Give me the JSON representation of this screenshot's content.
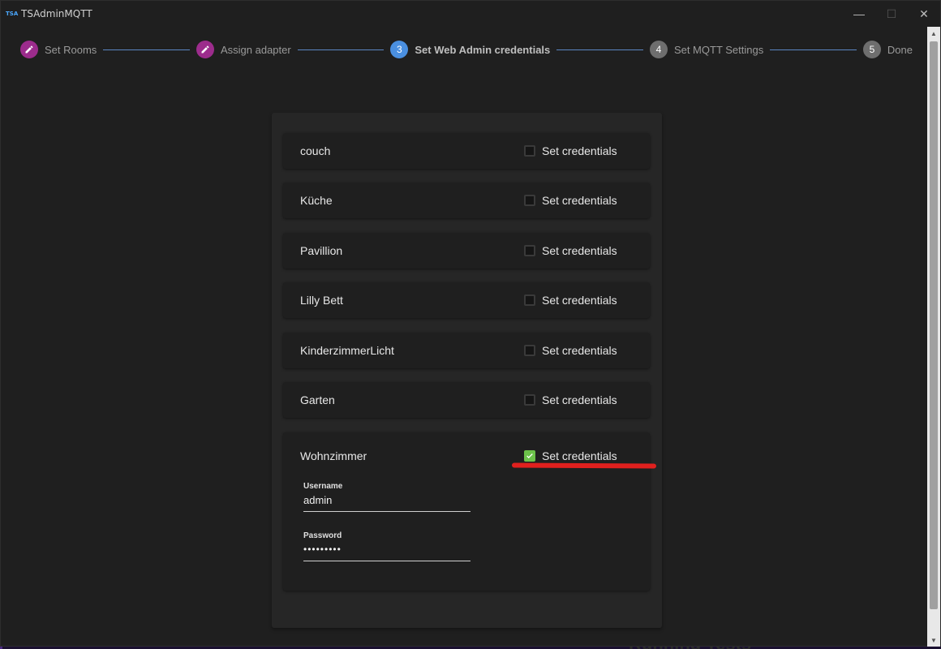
{
  "window": {
    "app_icon": "TSA",
    "title": "TSAdminMQTT",
    "controls": {
      "minimize": "—",
      "maximize": "☐",
      "close": "✕"
    }
  },
  "stepper": {
    "steps": [
      {
        "number": "",
        "icon": "pencil-icon",
        "label": "Set Rooms",
        "state": "done"
      },
      {
        "number": "",
        "icon": "pencil-icon",
        "label": "Assign adapter",
        "state": "done"
      },
      {
        "number": "3",
        "label": "Set Web Admin credentials",
        "state": "active"
      },
      {
        "number": "4",
        "label": "Set MQTT Settings",
        "state": "todo"
      },
      {
        "number": "5",
        "label": "Done",
        "state": "todo"
      }
    ]
  },
  "rooms": [
    {
      "name": "couch",
      "checkbox_label": "Set credentials",
      "checked": false
    },
    {
      "name": "Küche",
      "checkbox_label": "Set credentials",
      "checked": false
    },
    {
      "name": "Pavillion",
      "checkbox_label": "Set credentials",
      "checked": false
    },
    {
      "name": "Lilly Bett",
      "checkbox_label": "Set credentials",
      "checked": false
    },
    {
      "name": "KinderzimmerLicht",
      "checkbox_label": "Set credentials",
      "checked": false
    },
    {
      "name": "Garten",
      "checkbox_label": "Set credentials",
      "checked": false
    },
    {
      "name": "Wohnzimmer",
      "checkbox_label": "Set credentials",
      "checked": true,
      "username_label": "Username",
      "username_value": "admin",
      "password_label": "Password",
      "password_value": "•••••••••"
    }
  ],
  "background": {
    "desktop_text": "Running Tests"
  },
  "colors": {
    "step_done": "#9c2c8c",
    "step_active": "#4a8fe0",
    "step_todo": "#6e6e6e",
    "checkbox_checked": "#6cc24a",
    "highlight": "#e0201e"
  }
}
